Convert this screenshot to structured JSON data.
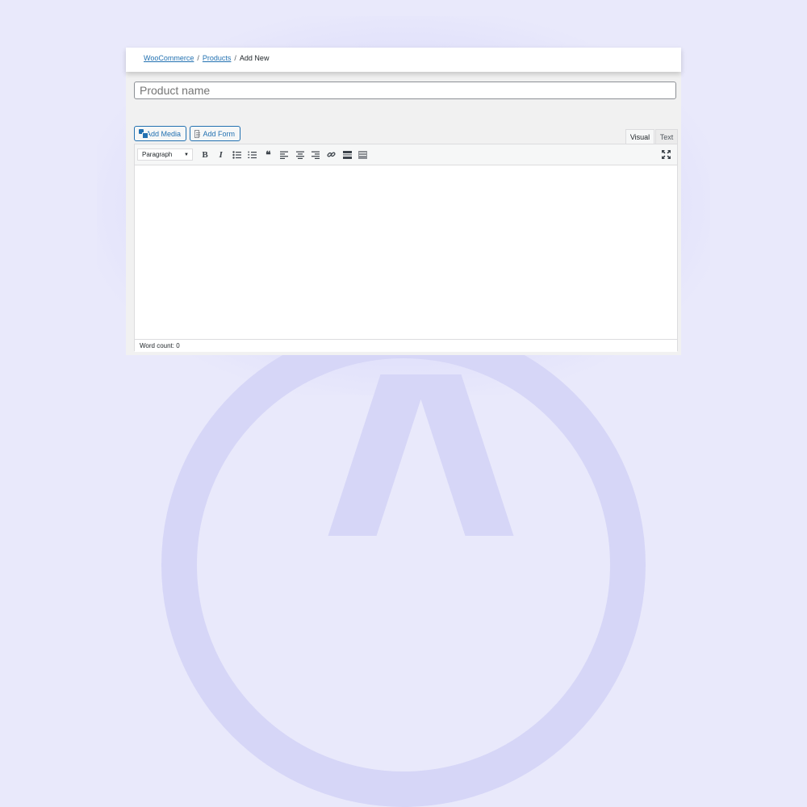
{
  "breadcrumb": {
    "items": [
      {
        "label": "WooCommerce",
        "link": true
      },
      {
        "label": "Products",
        "link": true
      },
      {
        "label": "Add New",
        "link": false
      }
    ],
    "separator": "/"
  },
  "title_field": {
    "placeholder": "Product name",
    "value": ""
  },
  "media_buttons": {
    "add_media_label": "Add Media",
    "add_form_label": "Add Form"
  },
  "editor_tabs": {
    "visual_label": "Visual",
    "text_label": "Text",
    "active": "Visual"
  },
  "toolbar": {
    "format_select_value": "Paragraph",
    "buttons": [
      {
        "icon": "bold-icon"
      },
      {
        "icon": "italic-icon"
      },
      {
        "icon": "bulleted-list-icon"
      },
      {
        "icon": "numbered-list-icon"
      },
      {
        "icon": "blockquote-icon"
      },
      {
        "icon": "align-left-icon"
      },
      {
        "icon": "align-center-icon"
      },
      {
        "icon": "align-right-icon"
      },
      {
        "icon": "insert-link-icon"
      },
      {
        "icon": "read-more-icon"
      },
      {
        "icon": "toolbar-toggle-icon"
      }
    ],
    "fullscreen_icon": "fullscreen-icon"
  },
  "status": {
    "word_count_text": "Word count: 0"
  },
  "colors": {
    "accent": "#2271b1",
    "background": "#e9e9fb",
    "panel": "#f1f1f1"
  }
}
